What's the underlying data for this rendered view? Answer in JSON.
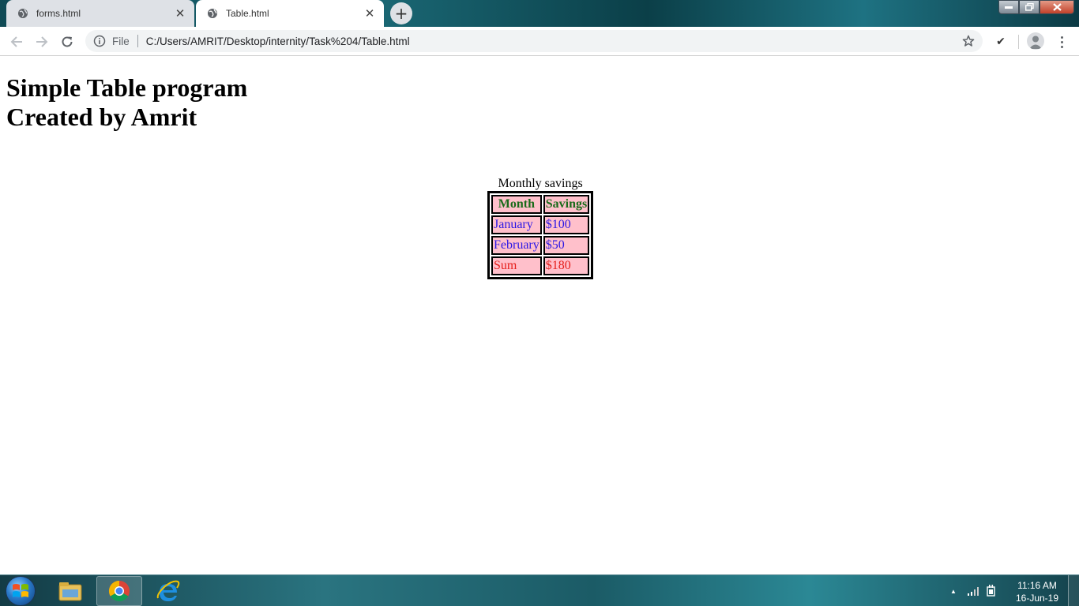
{
  "browser": {
    "tabs": [
      {
        "title": "forms.html",
        "active": false
      },
      {
        "title": "Table.html",
        "active": true
      }
    ],
    "new_tab_label": "+",
    "address": {
      "scheme_label": "File",
      "url": "C:/Users/AMRIT/Desktop/internity/Task%204/Table.html"
    },
    "extension_checkmark": "✔"
  },
  "page": {
    "heading_line1": "Simple Table program",
    "heading_line2": "Created by Amrit",
    "table": {
      "caption": "Monthly savings",
      "headers": [
        "Month",
        "Savings"
      ],
      "rows": [
        {
          "month": "January",
          "savings": "$100"
        },
        {
          "month": "February",
          "savings": "$50"
        }
      ],
      "footer": {
        "month": "Sum",
        "savings": "$180"
      },
      "colors": {
        "cell_background": "#ffc0cb",
        "header_text": "#1a6b1a",
        "body_text": "#2b16e6",
        "footer_text": "#e5201c"
      }
    }
  },
  "taskbar": {
    "time": "11:16 AM",
    "date": "16-Jun-19",
    "tray_expand": "▲"
  }
}
